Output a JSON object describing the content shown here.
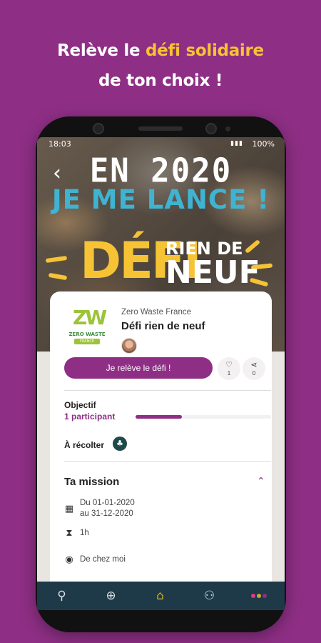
{
  "promo": {
    "line1_prefix": "Relève le ",
    "line1_highlight": "défi solidaire",
    "line2": "de ton choix !"
  },
  "status_bar": {
    "time": "18:03",
    "battery": "100%"
  },
  "hero": {
    "line1": "EN 2020",
    "line2": "JE ME LANCE !",
    "defi": "DÉFI",
    "rien": "RIEN DE",
    "neuf": "NEUF"
  },
  "challenge": {
    "organization": "Zero Waste France",
    "title": "Défi rien de neuf",
    "logo_text": "ZW",
    "logo_name": "ZERO WASTE",
    "logo_sub": "FRANCE",
    "cta_label": "Je relève le défi !",
    "likes_count": "1",
    "shares_count": "0"
  },
  "objective": {
    "label": "Objectif",
    "participants": "1 participant",
    "progress": 0.34
  },
  "harvest": {
    "label": "À récolter"
  },
  "mission": {
    "title": "Ta mission",
    "date_line1": "Du 01-01-2020",
    "date_line2": "au 31-12-2020",
    "duration": "1h",
    "location": "De chez moi"
  },
  "nav": {
    "items": [
      "search-icon",
      "add-icon",
      "home-icon",
      "community-icon",
      "more-icon"
    ],
    "active": "home-icon"
  },
  "colors": {
    "brand_purple": "#8e2f85",
    "highlight_yellow": "#f6c335",
    "nav_dark": "#1e3a49",
    "accent_blue": "#3fb3d2",
    "dot_pink": "#e5397e",
    "dot_gold": "#c9a92a",
    "dot_purple": "#8e2f85"
  }
}
